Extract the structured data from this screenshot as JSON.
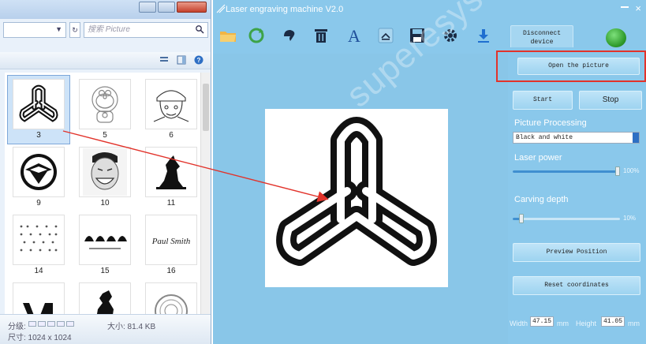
{
  "explorer": {
    "search_placeholder": "搜索 Picture",
    "thumbnails": [
      {
        "label": "3",
        "icon": "trefoil-chain-icon",
        "selected": true
      },
      {
        "label": "5",
        "icon": "doraemon-drawing-icon",
        "selected": false
      },
      {
        "label": "6",
        "icon": "cartoon-character-drawing-icon",
        "selected": false
      },
      {
        "label": "9",
        "icon": "eagle-shield-logo-icon",
        "selected": false
      },
      {
        "label": "10",
        "icon": "meme-face-photo-icon",
        "selected": false
      },
      {
        "label": "11",
        "icon": "wolf-howling-silhouette-icon",
        "selected": false
      },
      {
        "label": "14",
        "icon": "dot-pattern-icon",
        "selected": false
      },
      {
        "label": "15",
        "icon": "hairstyles-icon",
        "selected": false
      },
      {
        "label": "16",
        "icon": "signature-icon",
        "selected": false
      },
      {
        "label": "",
        "icon": "lv-logo-icon",
        "selected": false
      },
      {
        "label": "",
        "icon": "horse-logo-icon",
        "selected": false
      },
      {
        "label": "",
        "icon": "medusa-logo-icon",
        "selected": false
      }
    ],
    "signature_text": "Paul Smith",
    "status": {
      "rating_label": "分级:",
      "size_label": "大小: 81.4 KB",
      "dimensions_label": "尺寸: 1024 x 1024"
    }
  },
  "app": {
    "title": "Laser engraving machine V2.0",
    "toolbar": {
      "tools": [
        {
          "name": "open-folder-icon"
        },
        {
          "name": "rotate-icon"
        },
        {
          "name": "flip-icon"
        },
        {
          "name": "delete-icon"
        },
        {
          "name": "text-icon",
          "glyph": "A"
        },
        {
          "name": "upload-icon"
        },
        {
          "name": "save-icon"
        },
        {
          "name": "settings-icon"
        },
        {
          "name": "download-icon"
        }
      ],
      "disconnect_label_1": "Disconnect",
      "disconnect_label_2": "device",
      "status_color": "#2e9a2b"
    },
    "canvas": {
      "watermark": "superesystem",
      "image": "trefoil-chain-icon"
    },
    "panel": {
      "open_picture": "Open the picture",
      "start": "Start",
      "stop": "Stop",
      "picture_processing_label": "Picture Processing",
      "processing_value": "Black and white",
      "laser_power_label": "Laser power",
      "laser_power_value": "100%",
      "laser_power_fraction": 1.0,
      "carving_depth_label": "Carving depth",
      "carving_depth_value": "10%",
      "carving_depth_fraction": 0.1,
      "preview_position": "Preview Position",
      "reset_coordinates": "Reset coordinates",
      "width_label": "Width",
      "width_value": "47.15",
      "width_unit": "mm",
      "height_label": "Height",
      "height_value": "41.05",
      "height_unit": "mm"
    },
    "accent_highlight": "#e2332b"
  }
}
